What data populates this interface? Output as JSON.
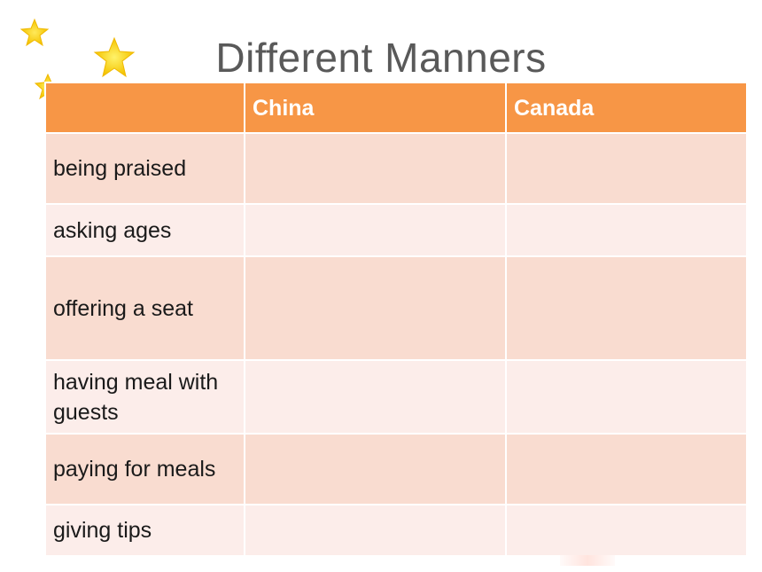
{
  "slide": {
    "title": "Different Manners"
  },
  "table": {
    "headers": [
      "",
      "China",
      "Canada"
    ],
    "rows": [
      {
        "topic": "being praised",
        "china": "",
        "canada": ""
      },
      {
        "topic": "asking ages",
        "china": "",
        "canada": ""
      },
      {
        "topic": "offering a seat",
        "china": "",
        "canada": ""
      },
      {
        "topic": "having meal with guests",
        "china": "",
        "canada": ""
      },
      {
        "topic": "paying for meals",
        "china": "",
        "canada": ""
      },
      {
        "topic": "giving tips",
        "china": "",
        "canada": ""
      }
    ]
  },
  "colors": {
    "header_bg": "#f79646",
    "row_odd_bg": "#f9dcd0",
    "row_even_bg": "#fcedea",
    "title_text": "#595959",
    "star_fill": "#ffe033"
  },
  "decorations": {
    "icons": [
      "star-icon",
      "star-icon",
      "star-icon"
    ]
  }
}
